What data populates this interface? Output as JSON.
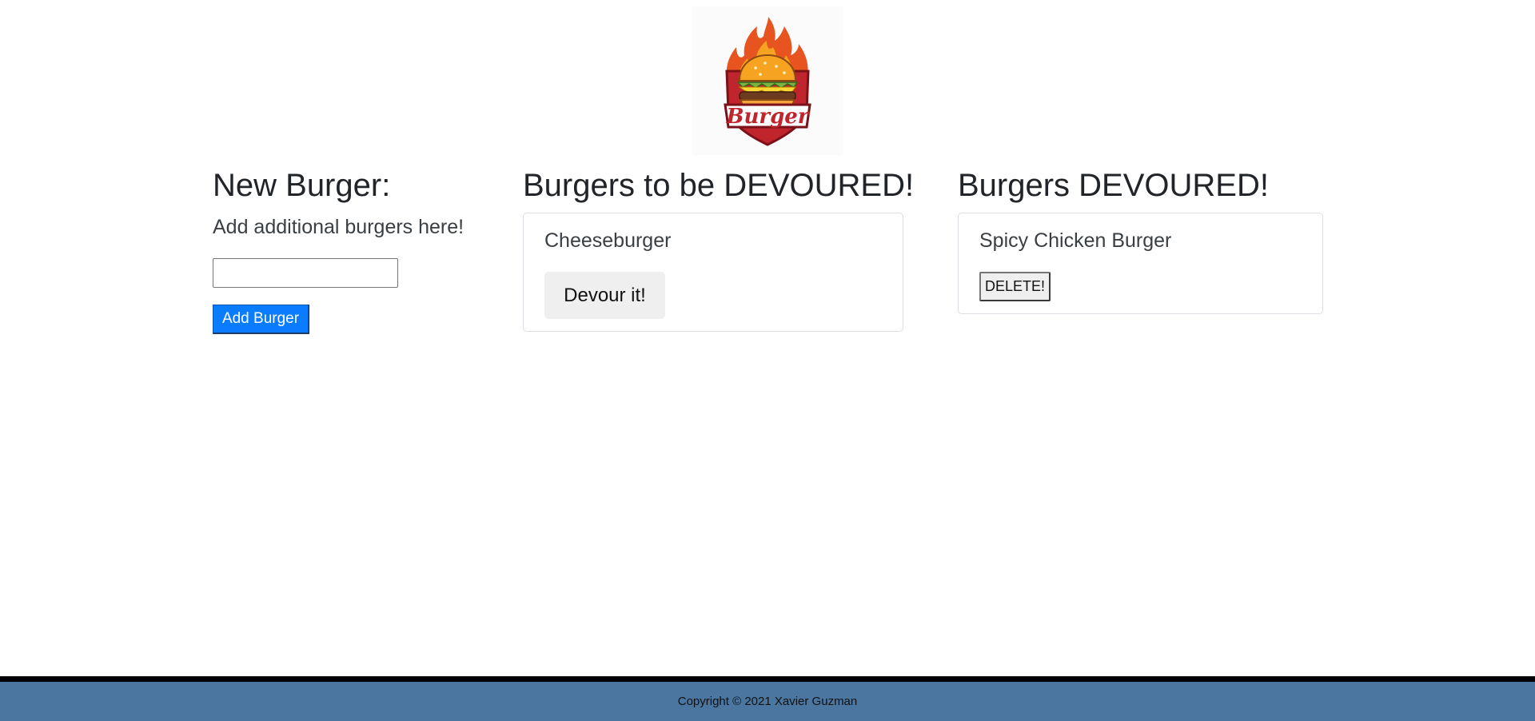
{
  "logo": {
    "name": "burger-flame-logo",
    "text": "Burger"
  },
  "new_burger": {
    "title": "New Burger:",
    "subtitle": "Add additional burgers here!",
    "input_value": "",
    "input_placeholder": "",
    "add_label": "Add Burger"
  },
  "to_devour": {
    "title": "Burgers to be DEVOURED!",
    "items": [
      {
        "name": "Cheeseburger",
        "button_label": "Devour it!"
      }
    ]
  },
  "devoured": {
    "title": "Burgers DEVOURED!",
    "items": [
      {
        "name": "Spicy Chicken Burger",
        "button_label": "DELETE!"
      }
    ]
  },
  "footer": {
    "copyright": "Copyright © 2021 Xavier Guzman"
  },
  "colors": {
    "primary_button": "#0a7cff",
    "footer_bar": "#4a76a0",
    "footer_border": "#000000",
    "heading_text": "#212529",
    "flame": "#e8541f",
    "shield": "#c0242c"
  }
}
